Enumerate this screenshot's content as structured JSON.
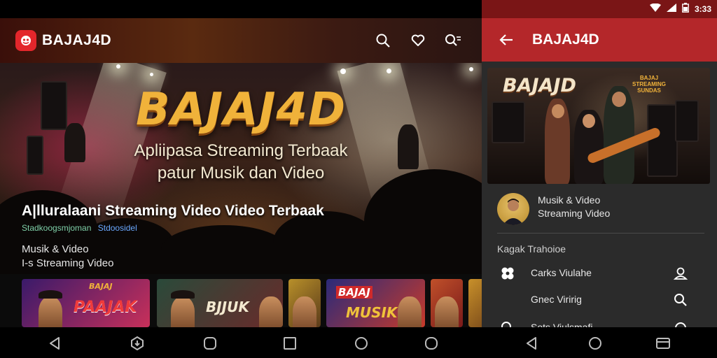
{
  "left": {
    "app_name": "BAJAJ4D",
    "hero": {
      "title": "BAJAJ4D",
      "tagline_line1": "Apliipasa Streaming Terbaak",
      "tagline_line2": "patur Musik dan Video"
    },
    "featured": {
      "title": "A|lluralaani Streaming Video Video Terbaak",
      "meta_primary": "Stadkoogsmjoman",
      "meta_secondary": "Stdoosidel",
      "category_line1": "Musik & Video",
      "category_line2": "I-s Streaming Video"
    },
    "thumbnails": [
      {
        "text_top": "BAJAJ",
        "text_main": "PAAJAK",
        "colors": [
          "#3a1a6a",
          "#c8305a"
        ]
      },
      {
        "text_top": "",
        "text_main": "BJJUK",
        "colors": [
          "#2a4a3a",
          "#6a2a2a"
        ]
      },
      {
        "text_top": "",
        "text_main": "",
        "colors": [
          "#b8902a",
          "#5a3a1a"
        ]
      },
      {
        "text_top": "BAJAJ",
        "text_main": "MUSIK",
        "colors": [
          "#2a2a7a",
          "#c83a2a"
        ]
      },
      {
        "text_top": "",
        "text_main": "",
        "colors": [
          "#c0502a",
          "#7a1a1a"
        ]
      },
      {
        "text_top": "",
        "text_main": "",
        "colors": [
          "#c8902a",
          "#7a4a1a"
        ]
      }
    ]
  },
  "right": {
    "status_time": "3:33",
    "title": "BAJAJ4D",
    "hero_title": "BAJAJD",
    "hero_badge": "BAJAJ STREAMING SUNDAS",
    "profile": {
      "line1": "Musik & Video",
      "line2": "Streaming Video"
    },
    "section_header": "Kagak Trahoioe",
    "menu": [
      {
        "label": "Carks Viulahe",
        "left_icon": "grid-icon",
        "right_icon": "user-icon"
      },
      {
        "label": "Gnec Viririg",
        "left_icon": "",
        "right_icon": "search-icon"
      },
      {
        "label": "Sots Viulsmafi",
        "left_icon": "search-icon",
        "right_icon": "settings-icon"
      }
    ]
  },
  "colors": {
    "brand_red": "#b4272a",
    "status_red": "#7a1516",
    "hero_gold": "#f0b23a"
  }
}
